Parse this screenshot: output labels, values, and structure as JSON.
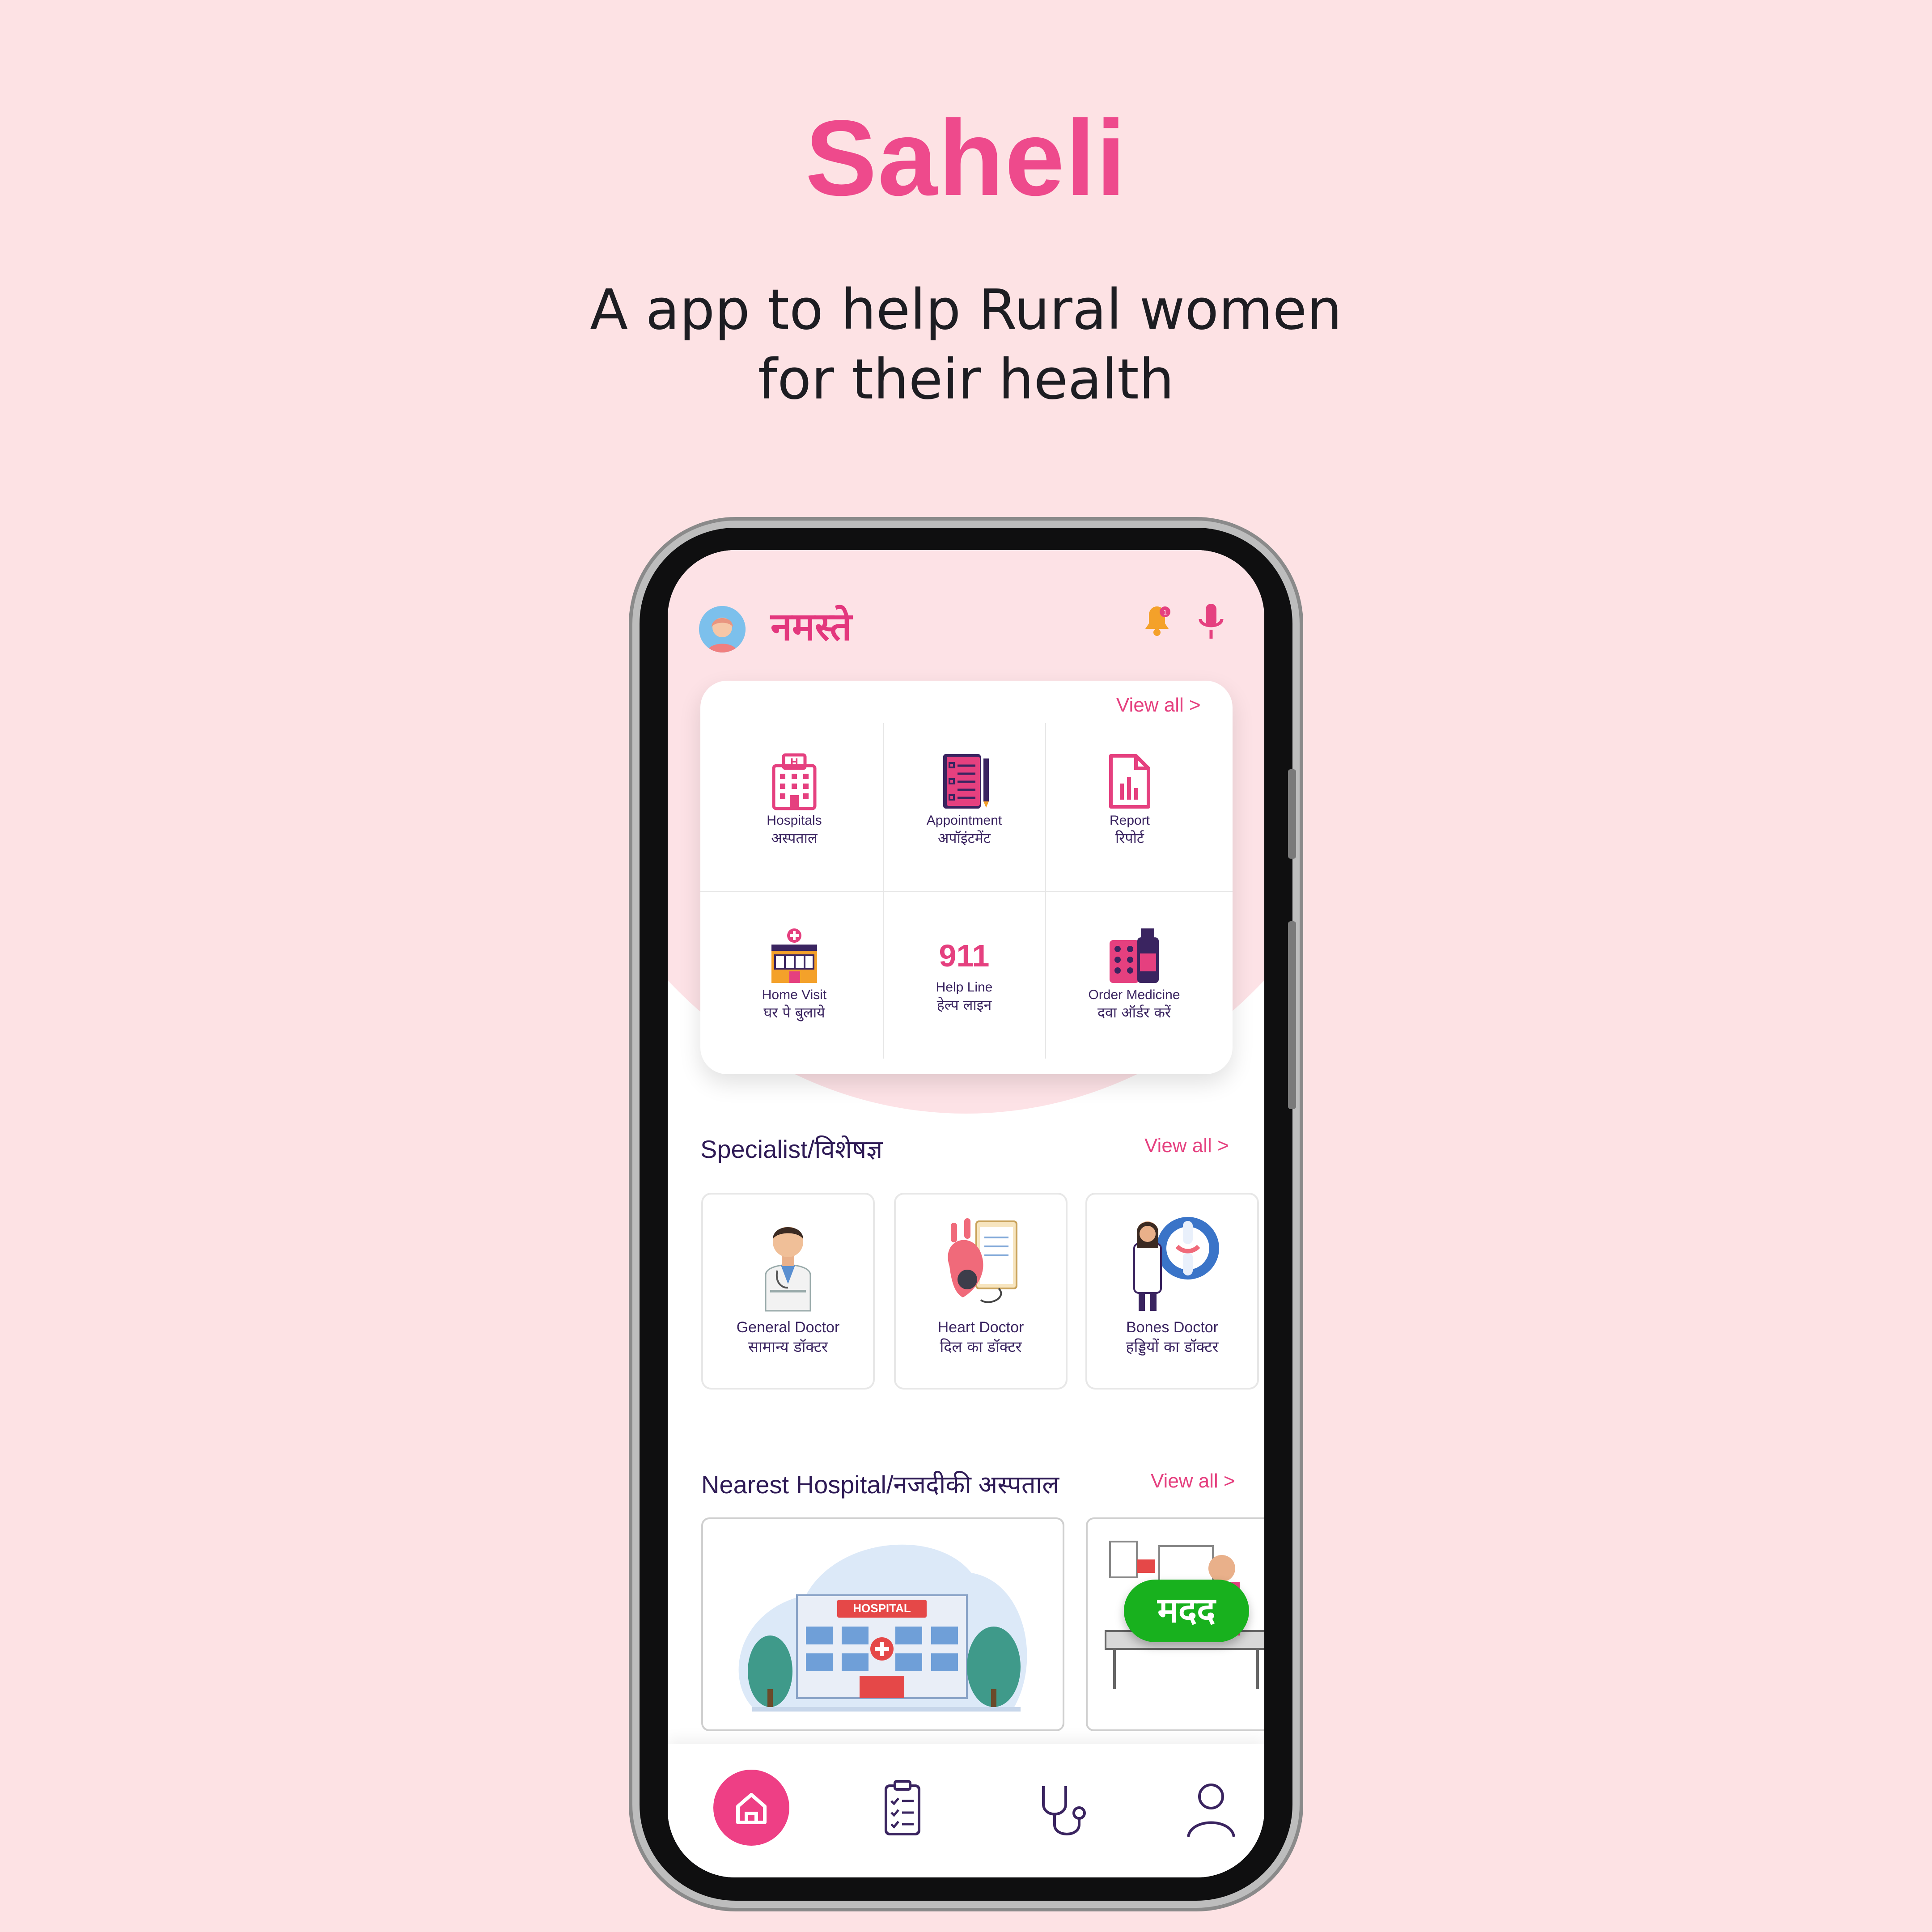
{
  "brand": {
    "title": "Saheli",
    "subtitle_line1": "A app to help Rural women",
    "subtitle_line2": "for their health"
  },
  "header": {
    "greeting": "नमस्ते",
    "notification_badge": "1"
  },
  "services": {
    "view_all": "View all >",
    "items": [
      {
        "en": "Hospitals",
        "hi": "अस्पताल",
        "icon": "hospital-building-icon"
      },
      {
        "en": "Appointment",
        "hi": "अपॉइंटमेंट",
        "icon": "appointment-notebook-icon"
      },
      {
        "en": "Report",
        "hi": "रिपोर्ट",
        "icon": "report-document-icon"
      },
      {
        "en": "Home Visit",
        "hi": "घर पे बुलाये",
        "icon": "clinic-building-icon"
      },
      {
        "en": "Help Line",
        "hi": "हेल्प लाइन",
        "number": "911"
      },
      {
        "en": "Order Medicine",
        "hi": "दवा ऑर्डर करें",
        "icon": "medicine-bottles-icon"
      }
    ]
  },
  "specialists": {
    "title": "Specialist/विशेषज्ञ",
    "view_all": "View all >",
    "items": [
      {
        "en": "General Doctor",
        "hi": "सामान्य डॉक्टर"
      },
      {
        "en": "Heart Doctor",
        "hi": "दिल का डॉक्टर"
      },
      {
        "en": "Bones Doctor",
        "hi": "हड्डियों का डॉक्टर"
      }
    ]
  },
  "hospitals": {
    "title": "Nearest Hospital/नजदीकी अस्पताल",
    "view_all": "View all >",
    "sign": "HOSPITAL"
  },
  "help_button": "मदद",
  "bottom_nav": [
    "home",
    "checklist",
    "stethoscope",
    "profile"
  ],
  "colors": {
    "accent": "#e5407f",
    "background": "#fde2e4",
    "help": "#18b11e"
  }
}
